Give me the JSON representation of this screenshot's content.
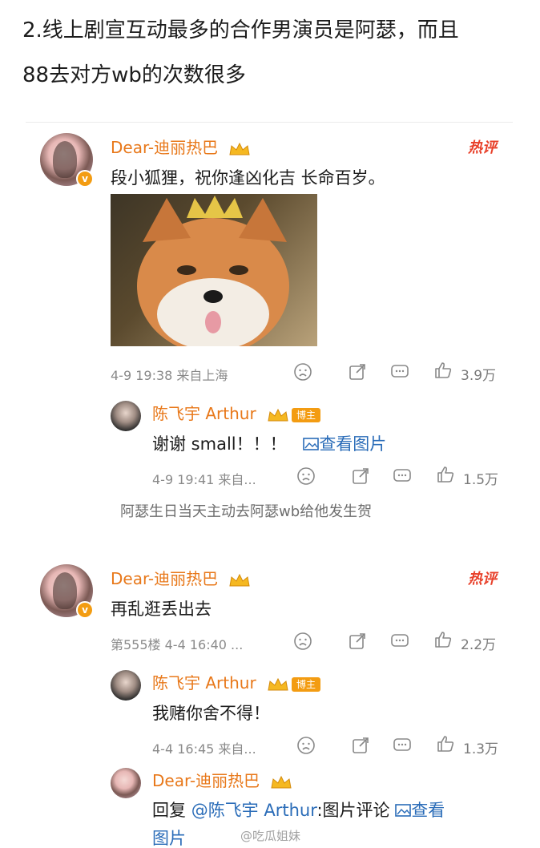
{
  "headline": {
    "line1": "2.线上剧宣互动最多的合作男演员是阿瑟，而且",
    "line2": "88去对方wb的次数很多"
  },
  "comment1": {
    "username": "Dear-迪丽热巴",
    "hot_label": "热评",
    "text": "段小狐狸，祝你逢凶化吉 长命百岁。",
    "meta": "4-9 19:38  来自上海",
    "likes": "3.9万",
    "reply": {
      "username": "陈飞宇 Arthur",
      "tag": "博主",
      "text": "谢谢 small！！！",
      "view_pic": "查看图片",
      "meta": "4-9 19:41  来自...",
      "likes": "1.5万"
    }
  },
  "note": "阿瑟生日当天主动去阿瑟wb给他发生贺",
  "comment2": {
    "username": "Dear-迪丽热巴",
    "hot_label": "热评",
    "text": "再乱逛丢出去",
    "meta": "第555楼  4-4 16:40  ...",
    "likes": "2.2万",
    "reply": {
      "username": "陈飞宇 Arthur",
      "tag": "博主",
      "text": "我赌你舍不得！",
      "meta": "4-4 16:45  来自...",
      "likes": "1.3万"
    },
    "reply2": {
      "username": "Dear-迪丽热巴",
      "prefix": "回复",
      "mention": "@陈飞宇 Arthur",
      "suffix": ":图片评论",
      "view_pic": "查看",
      "view_pic2": "图片"
    }
  },
  "watermark": "@吃瓜姐妹",
  "colors": {
    "username": "#e8781a",
    "link": "#2a6cb8",
    "hot": "#e8402a"
  }
}
